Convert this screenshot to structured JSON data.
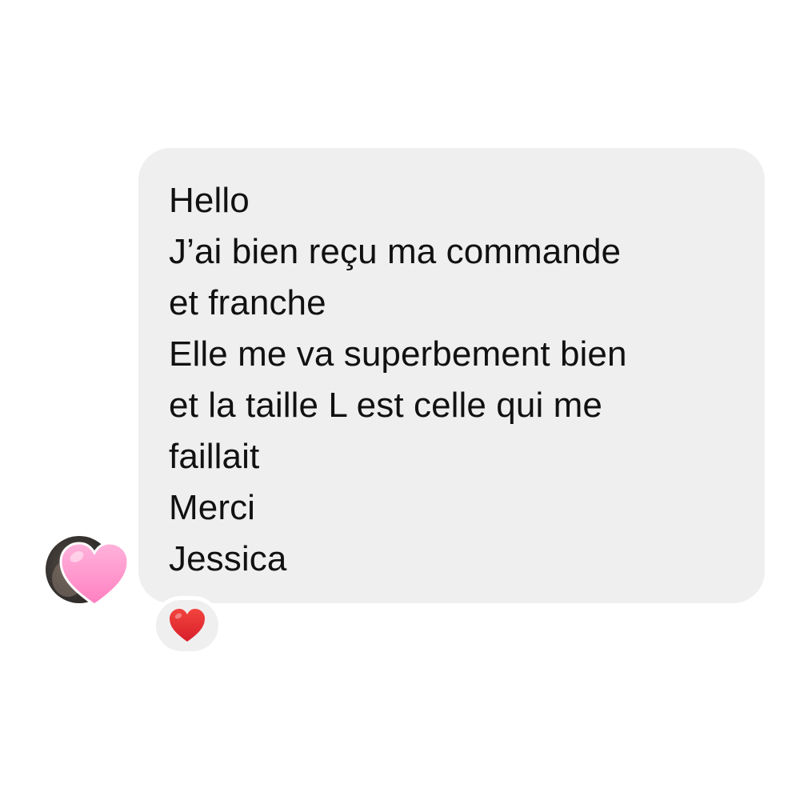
{
  "conversation": {
    "message": {
      "lines": [
        "Hello",
        "J’ai bien reçu ma commande",
        "et franche",
        "Elle me va superbement bien",
        "et la taille L est celle qui me",
        "faillait",
        "Merci",
        "Jessica"
      ]
    },
    "sender": {
      "avatar_icon": "person-photo",
      "overlay_icon": "pink-heart-icon",
      "overlay_color": "#ff8fc8"
    },
    "reaction": {
      "icon": "red-heart-icon",
      "color": "#e8262f"
    }
  }
}
